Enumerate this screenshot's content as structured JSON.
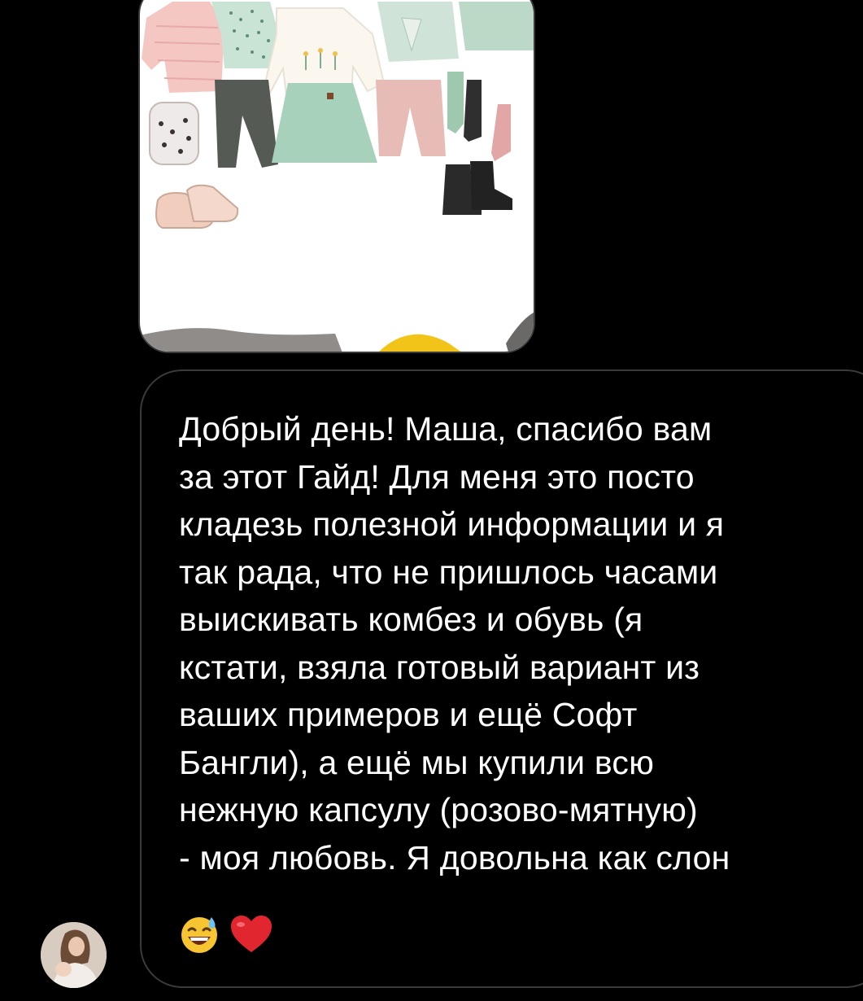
{
  "conversation": {
    "image_message": {
      "icon": "outfit-collage-image"
    },
    "text_message": {
      "text": "Добрый день! Маша, спасибо вам\nза этот Гайд! Для меня это посто\nкладезь полезной информации и я\nтак рада, что не пришлось часами\nвыискивать комбез и обувь (я\nкстати, взяла готовый вариант из\nваших примеров и ещё Софт\nБангли), а ещё мы купили всю\nнежную капсулу (розово-мятную)\n- моя любовь. Я довольна как слон",
      "emojis": [
        "sweat-smile-emoji",
        "red-heart-emoji"
      ]
    },
    "sender": {
      "avatar_icon": "user-avatar"
    }
  },
  "colors": {
    "background": "#000000",
    "bubble_border": "#3a3a3c",
    "text": "#ffffff"
  }
}
